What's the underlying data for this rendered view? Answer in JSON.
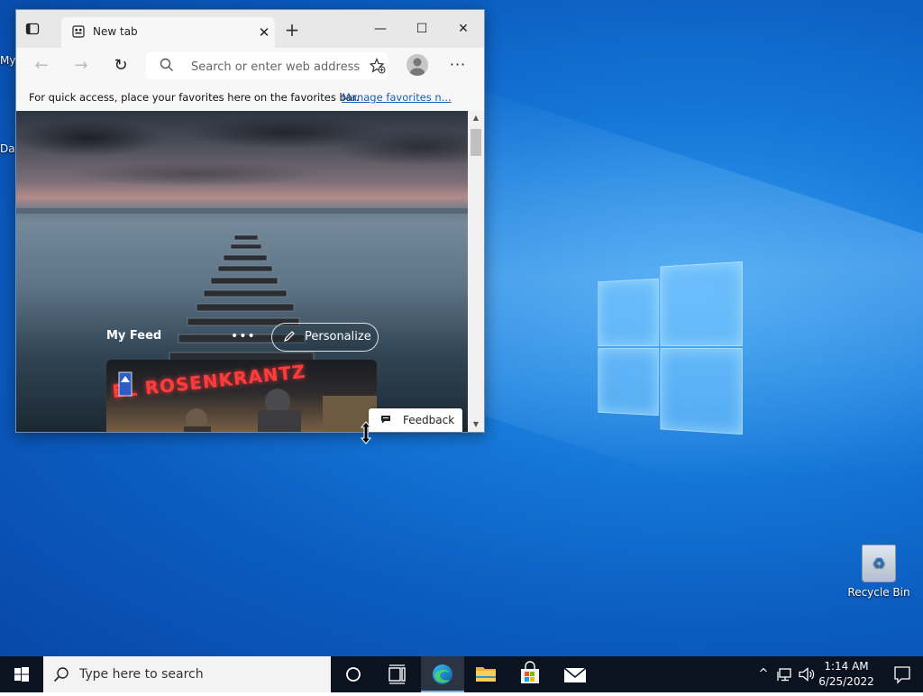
{
  "desktop": {
    "edge_texts": [
      "My",
      "Da"
    ],
    "recycle_bin_label": "Recycle Bin"
  },
  "browser": {
    "tab": {
      "title": "New tab",
      "close_glyph": "✕"
    },
    "new_tab_glyph": "+",
    "controls": {
      "minimize": "—",
      "maximize": "☐",
      "close": "✕"
    },
    "nav": {
      "back": "←",
      "forward": "→",
      "refresh": "↻"
    },
    "address": {
      "placeholder": "Search or enter web address"
    },
    "more_glyph": "···",
    "favbar": {
      "message": "For quick access, place your favorites here on the favorites bar.",
      "link": "Manage favorites n..."
    },
    "content": {
      "feed_title": "My Feed",
      "dots": "•••",
      "personalize_label": "Personalize",
      "card_sign": "EL ROSENKRANTZ",
      "feedback_label": "Feedback"
    }
  },
  "taskbar": {
    "search_text": "Type here to search",
    "clock_time": "1:14 AM",
    "clock_date": "6/25/2022",
    "tray_chevron": "^"
  },
  "colors": {
    "desktop_blue": "#1577d8",
    "taskbar": "#0c1320",
    "edge_accent": "#1a75d2"
  }
}
